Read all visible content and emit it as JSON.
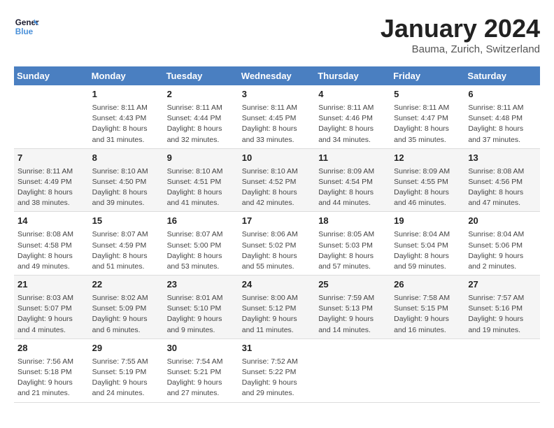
{
  "header": {
    "logo_line1": "General",
    "logo_line2": "Blue",
    "month_year": "January 2024",
    "location": "Bauma, Zurich, Switzerland"
  },
  "weekdays": [
    "Sunday",
    "Monday",
    "Tuesday",
    "Wednesday",
    "Thursday",
    "Friday",
    "Saturday"
  ],
  "weeks": [
    [
      {
        "num": "",
        "info": ""
      },
      {
        "num": "1",
        "info": "Sunrise: 8:11 AM\nSunset: 4:43 PM\nDaylight: 8 hours\nand 31 minutes."
      },
      {
        "num": "2",
        "info": "Sunrise: 8:11 AM\nSunset: 4:44 PM\nDaylight: 8 hours\nand 32 minutes."
      },
      {
        "num": "3",
        "info": "Sunrise: 8:11 AM\nSunset: 4:45 PM\nDaylight: 8 hours\nand 33 minutes."
      },
      {
        "num": "4",
        "info": "Sunrise: 8:11 AM\nSunset: 4:46 PM\nDaylight: 8 hours\nand 34 minutes."
      },
      {
        "num": "5",
        "info": "Sunrise: 8:11 AM\nSunset: 4:47 PM\nDaylight: 8 hours\nand 35 minutes."
      },
      {
        "num": "6",
        "info": "Sunrise: 8:11 AM\nSunset: 4:48 PM\nDaylight: 8 hours\nand 37 minutes."
      }
    ],
    [
      {
        "num": "7",
        "info": "Sunrise: 8:11 AM\nSunset: 4:49 PM\nDaylight: 8 hours\nand 38 minutes."
      },
      {
        "num": "8",
        "info": "Sunrise: 8:10 AM\nSunset: 4:50 PM\nDaylight: 8 hours\nand 39 minutes."
      },
      {
        "num": "9",
        "info": "Sunrise: 8:10 AM\nSunset: 4:51 PM\nDaylight: 8 hours\nand 41 minutes."
      },
      {
        "num": "10",
        "info": "Sunrise: 8:10 AM\nSunset: 4:52 PM\nDaylight: 8 hours\nand 42 minutes."
      },
      {
        "num": "11",
        "info": "Sunrise: 8:09 AM\nSunset: 4:54 PM\nDaylight: 8 hours\nand 44 minutes."
      },
      {
        "num": "12",
        "info": "Sunrise: 8:09 AM\nSunset: 4:55 PM\nDaylight: 8 hours\nand 46 minutes."
      },
      {
        "num": "13",
        "info": "Sunrise: 8:08 AM\nSunset: 4:56 PM\nDaylight: 8 hours\nand 47 minutes."
      }
    ],
    [
      {
        "num": "14",
        "info": "Sunrise: 8:08 AM\nSunset: 4:58 PM\nDaylight: 8 hours\nand 49 minutes."
      },
      {
        "num": "15",
        "info": "Sunrise: 8:07 AM\nSunset: 4:59 PM\nDaylight: 8 hours\nand 51 minutes."
      },
      {
        "num": "16",
        "info": "Sunrise: 8:07 AM\nSunset: 5:00 PM\nDaylight: 8 hours\nand 53 minutes."
      },
      {
        "num": "17",
        "info": "Sunrise: 8:06 AM\nSunset: 5:02 PM\nDaylight: 8 hours\nand 55 minutes."
      },
      {
        "num": "18",
        "info": "Sunrise: 8:05 AM\nSunset: 5:03 PM\nDaylight: 8 hours\nand 57 minutes."
      },
      {
        "num": "19",
        "info": "Sunrise: 8:04 AM\nSunset: 5:04 PM\nDaylight: 8 hours\nand 59 minutes."
      },
      {
        "num": "20",
        "info": "Sunrise: 8:04 AM\nSunset: 5:06 PM\nDaylight: 9 hours\nand 2 minutes."
      }
    ],
    [
      {
        "num": "21",
        "info": "Sunrise: 8:03 AM\nSunset: 5:07 PM\nDaylight: 9 hours\nand 4 minutes."
      },
      {
        "num": "22",
        "info": "Sunrise: 8:02 AM\nSunset: 5:09 PM\nDaylight: 9 hours\nand 6 minutes."
      },
      {
        "num": "23",
        "info": "Sunrise: 8:01 AM\nSunset: 5:10 PM\nDaylight: 9 hours\nand 9 minutes."
      },
      {
        "num": "24",
        "info": "Sunrise: 8:00 AM\nSunset: 5:12 PM\nDaylight: 9 hours\nand 11 minutes."
      },
      {
        "num": "25",
        "info": "Sunrise: 7:59 AM\nSunset: 5:13 PM\nDaylight: 9 hours\nand 14 minutes."
      },
      {
        "num": "26",
        "info": "Sunrise: 7:58 AM\nSunset: 5:15 PM\nDaylight: 9 hours\nand 16 minutes."
      },
      {
        "num": "27",
        "info": "Sunrise: 7:57 AM\nSunset: 5:16 PM\nDaylight: 9 hours\nand 19 minutes."
      }
    ],
    [
      {
        "num": "28",
        "info": "Sunrise: 7:56 AM\nSunset: 5:18 PM\nDaylight: 9 hours\nand 21 minutes."
      },
      {
        "num": "29",
        "info": "Sunrise: 7:55 AM\nSunset: 5:19 PM\nDaylight: 9 hours\nand 24 minutes."
      },
      {
        "num": "30",
        "info": "Sunrise: 7:54 AM\nSunset: 5:21 PM\nDaylight: 9 hours\nand 27 minutes."
      },
      {
        "num": "31",
        "info": "Sunrise: 7:52 AM\nSunset: 5:22 PM\nDaylight: 9 hours\nand 29 minutes."
      },
      {
        "num": "",
        "info": ""
      },
      {
        "num": "",
        "info": ""
      },
      {
        "num": "",
        "info": ""
      }
    ]
  ]
}
